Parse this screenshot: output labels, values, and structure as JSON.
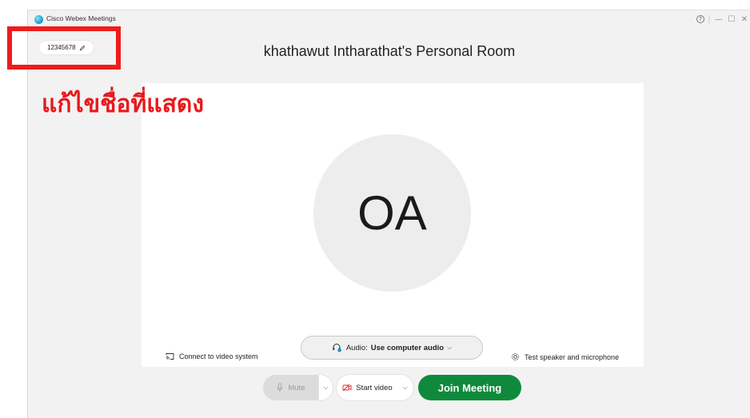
{
  "window": {
    "app_title": "Cisco Webex Meetings",
    "controls": {
      "help": "?",
      "minimize": "—",
      "maximize": "☐",
      "close": "✕"
    }
  },
  "header": {
    "display_name": "12345678",
    "room_title": "khathawut Intharathat's Personal Room"
  },
  "preview": {
    "avatar_initials": "OA"
  },
  "options": {
    "connect_video_label": "Connect to video system",
    "audio_prefix": "Audio:",
    "audio_value": "Use computer audio",
    "test_speaker_label": "Test speaker and microphone"
  },
  "controls": {
    "mute_label": "Mute",
    "start_video_label": "Start video",
    "join_label": "Join Meeting"
  },
  "annotation": {
    "text": "แก้ไขชื่อที่แสดง"
  },
  "colors": {
    "join_green": "#0f8a3c",
    "annotation_red": "#e8191c"
  }
}
